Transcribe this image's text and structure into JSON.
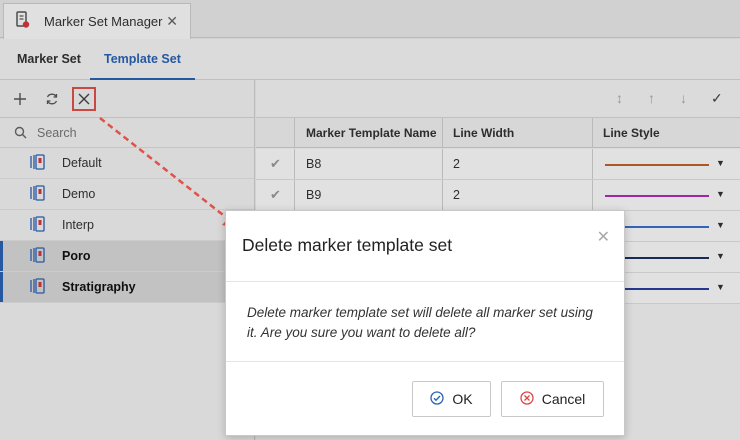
{
  "window": {
    "tab_title": "Marker Set Manager",
    "close_glyph": "✕"
  },
  "subtabs": [
    {
      "label": "Marker Set",
      "active": false
    },
    {
      "label": "Template Set",
      "active": true
    }
  ],
  "left_toolbar": {
    "add_icon": "plus-icon",
    "refresh_icon": "refresh-icon",
    "delete_icon": "delete-icon"
  },
  "search": {
    "placeholder": "Search"
  },
  "template_sets": [
    {
      "label": "Default",
      "selected": false
    },
    {
      "label": "Demo",
      "selected": false
    },
    {
      "label": "Interp",
      "selected": false
    },
    {
      "label": "Poro",
      "selected": true
    },
    {
      "label": "Stratigraphy",
      "selected": true
    }
  ],
  "grid": {
    "columns": [
      "Marker Template Name",
      "Line Width",
      "Line Style"
    ],
    "rows": [
      {
        "name": "B8",
        "width": "2",
        "color": "#c0622a"
      },
      {
        "name": "B9",
        "width": "2",
        "color": "#b02cb8"
      }
    ],
    "partial_line_colors": [
      "#3a6fd0",
      "#1a3360",
      "#2a3fa0"
    ]
  },
  "dialog": {
    "title": "Delete marker template set",
    "message": "Delete marker template set will delete all marker set using it. Are you sure you want to delete all?",
    "ok_label": "OK",
    "cancel_label": "Cancel"
  },
  "colors": {
    "accent": "#2b63b5",
    "highlight": "#e0514a",
    "cancel_icon": "#e04646"
  }
}
